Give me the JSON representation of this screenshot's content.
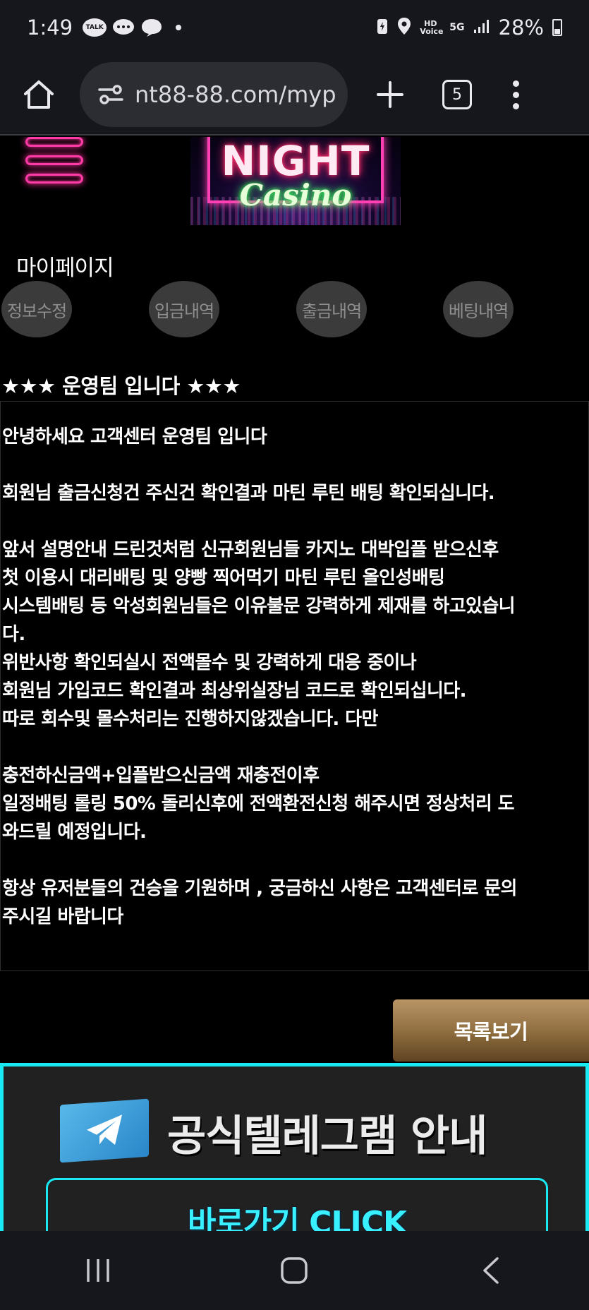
{
  "status_bar": {
    "time": "1:49",
    "notif_talk": "TALK",
    "hd_voice": "HD Voice",
    "network": "5G",
    "battery_percent": "28%"
  },
  "browser": {
    "url": "nt88-88.com/myp",
    "tab_count": "5"
  },
  "site": {
    "logo_line1": "NIGHT",
    "logo_line2": "Casino",
    "page_title": "마이페이지",
    "tabs": [
      "정보수정",
      "입금내역",
      "출금내역",
      "베팅내역"
    ]
  },
  "post": {
    "title": "★★★ 운영팀 입니다 ★★★",
    "paragraphs": [
      [
        "안녕하세요 고객센터 운영팀 입니다"
      ],
      [
        "회원님 출금신청건 주신건 확인결과 마틴 루틴 배팅 확인되십니다."
      ],
      [
        "앞서 설명안내 드린것처럼 신규회원님들 카지노 대박입플 받으신후",
        "첫 이용시 대리배팅 및 양빵 찍어먹기 마틴 루틴 올인성배팅",
        "시스템배팅 등 악성회원님들은 이유불문 강력하게 제재를 하고있습니",
        "다.",
        "위반사항 확인되실시 전액몰수 및 강력하게 대응 중이나",
        "회원님 가입코드 확인결과 최상위실장님 코드로 확인되십니다.",
        "따로 회수및 몰수처리는 진행하지않겠습니다. 다만"
      ],
      [
        "충전하신금액+입플받으신금액 재충전이후",
        "일정배팅 롤링 50% 돌리신후에 전액환전신청 해주시면 정상처리 도",
        "와드릴 예정입니다."
      ],
      [
        "항상 유저분들의 건승을 기원하며 , 궁금하신 사항은 고객센터로 문의",
        "주시길 바랍니다"
      ]
    ]
  },
  "list_button": "목록보기",
  "telegram_banner": {
    "title": "공식텔레그램 안내",
    "click_label": "바로가기 CLICK"
  },
  "colors": {
    "neon_cyan": "#19e9f3",
    "neon_pink": "#ff3ba7",
    "gold_button": "#8c6b3c"
  }
}
